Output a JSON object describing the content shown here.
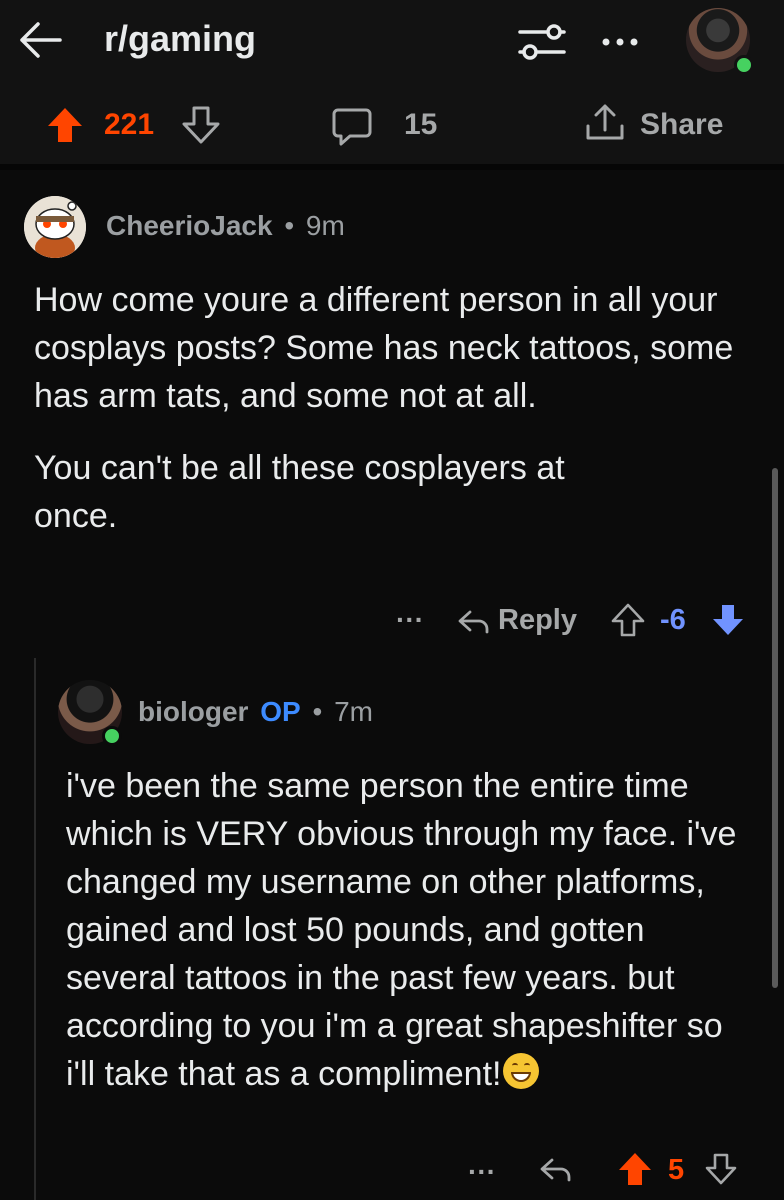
{
  "header": {
    "title": "r/gaming",
    "vote_count": "221",
    "comment_count": "15",
    "share_label": "Share"
  },
  "comments": [
    {
      "author": "CheerioJack",
      "separator": "•",
      "time": "9m",
      "paragraphs": [
        "How come youre a different person in all your cosplays posts? Some has neck tattoos, some has arm tats, and some not at all.",
        "You can't be all these cosplayers at once."
      ],
      "more": "···",
      "reply_label": "Reply",
      "score": "-6"
    },
    {
      "author": "biologer",
      "op_badge": "OP",
      "separator": "•",
      "time": "7m",
      "text": "i've been the same person the entire time which is VERY obvious through my face. i've changed my username on other platforms, gained and lost 50 pounds, and gotten several tattoos in the past few years. but according to you i'm a great shapeshifter so i'll take that as a compliment!",
      "emoji": "grinning-face-emoji",
      "more": "···",
      "score": "5"
    }
  ],
  "colors": {
    "upvote": "#ff4500",
    "downvote": "#7193ff",
    "op": "#3d8bff",
    "online": "#46d160"
  }
}
